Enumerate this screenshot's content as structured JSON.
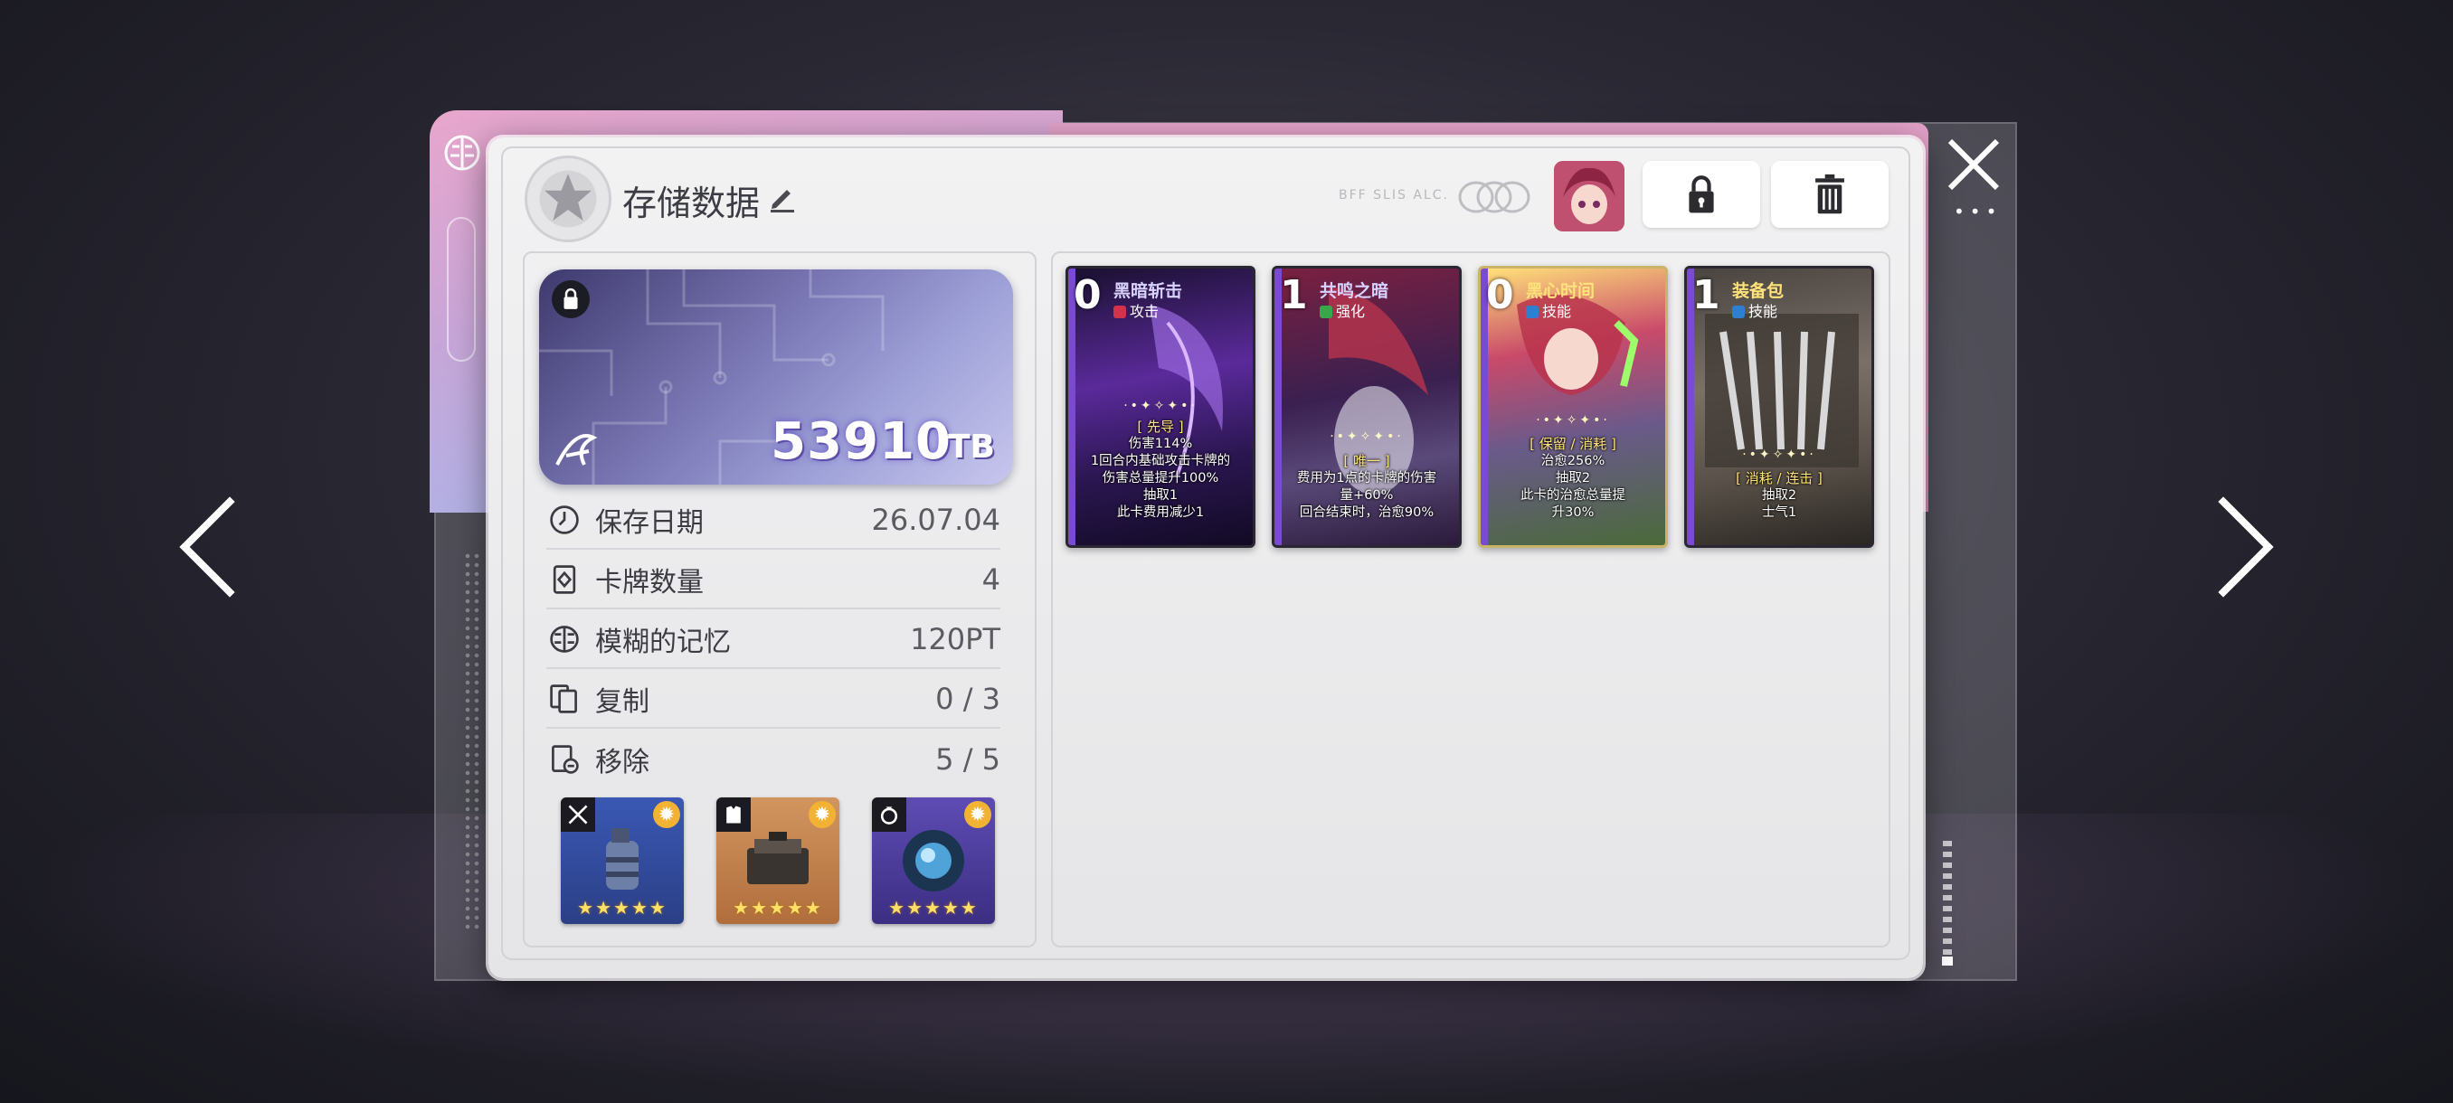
{
  "save": {
    "title": "存储数据",
    "faint_label": "BFF SLIS ALC.",
    "tb_amount": "53910",
    "tb_unit": "TB"
  },
  "stats": [
    {
      "label": "保存日期",
      "value": "26.07.04",
      "icon": "clock-icon"
    },
    {
      "label": "卡牌数量",
      "value": "4",
      "icon": "cards-icon"
    },
    {
      "label": "模糊的记忆",
      "value": "120PT",
      "icon": "brain-icon"
    },
    {
      "label": "复制",
      "value": "0 / 3",
      "icon": "copy-icon"
    },
    {
      "label": "移除",
      "value": "5 / 5",
      "icon": "remove-icon"
    }
  ],
  "items": [
    {
      "name": "grenade-item",
      "type_icon": "sword-icon",
      "stars": "★★★★★",
      "color": "#3d5aa8"
    },
    {
      "name": "armor-item",
      "type_icon": "armor-icon",
      "stars": "★★★★★",
      "color": "#c9865a"
    },
    {
      "name": "orb-item",
      "type_icon": "ring-icon",
      "stars": "★★★★★",
      "color": "#5a4aa8"
    }
  ],
  "cards": [
    {
      "cost": "0",
      "name": "黑暗斩击",
      "type": "攻击",
      "type_color": "#d2334b",
      "name_color": "#d9d2ff",
      "tag": "[ 先导 ]",
      "lines": [
        "伤害114%",
        "1回合内基础攻击卡牌的",
        "伤害总量提升100%",
        "抽取1",
        "此卡费用减少1"
      ]
    },
    {
      "cost": "1",
      "name": "共鸣之暗",
      "type": "强化",
      "type_color": "#37a84a",
      "name_color": "#d9d2ff",
      "tag": "[ 唯一 ]",
      "lines": [
        "费用为1点的卡牌的伤害",
        "量+60%",
        "回合结束时，治愈90%"
      ]
    },
    {
      "cost": "0",
      "name": "黑心时间",
      "type": "技能",
      "type_color": "#2f7fd1",
      "name_color": "#ffe27a",
      "tag": "[ 保留 / 消耗 ]",
      "lines": [
        "治愈256%",
        "抽取2",
        "此卡的治愈总量提",
        "升30%"
      ]
    },
    {
      "cost": "1",
      "name": "装备包",
      "type": "技能",
      "type_color": "#2f7fd1",
      "name_color": "#ffe27a",
      "tag": "[ 消耗 / 连击 ]",
      "lines": [
        "抽取2",
        "士气1"
      ]
    }
  ]
}
